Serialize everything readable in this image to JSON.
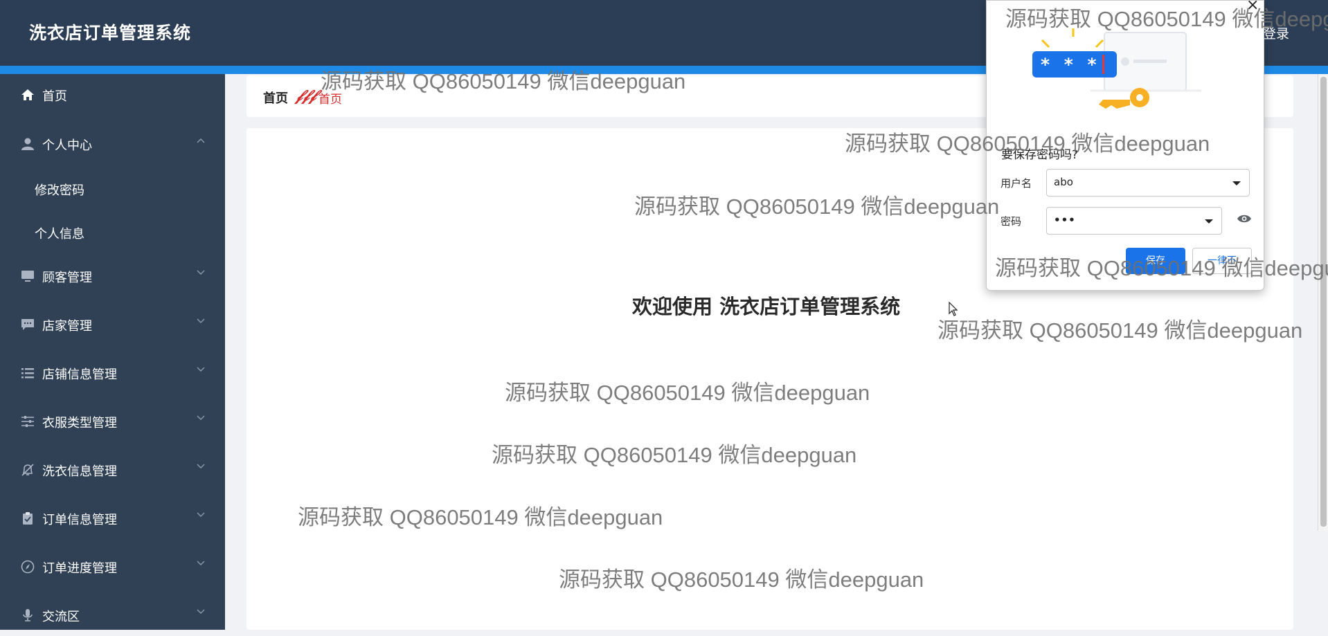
{
  "header": {
    "title": "洗衣店订单管理系统",
    "login_label": "登录"
  },
  "sidebar": {
    "items": [
      {
        "label": "首页",
        "icon": "home-icon",
        "expandable": false
      },
      {
        "label": "个人中心",
        "icon": "user-icon",
        "expandable": true,
        "expanded": true
      },
      {
        "label": "修改密码",
        "submenu": true
      },
      {
        "label": "个人信息",
        "submenu": true
      },
      {
        "label": "顾客管理",
        "icon": "monitor-icon",
        "expandable": true
      },
      {
        "label": "店家管理",
        "icon": "chat-icon",
        "expandable": true
      },
      {
        "label": "店铺信息管理",
        "icon": "list-icon",
        "expandable": true
      },
      {
        "label": "衣服类型管理",
        "icon": "sliders-icon",
        "expandable": true
      },
      {
        "label": "洗衣信息管理",
        "icon": "bell-off-icon",
        "expandable": true
      },
      {
        "label": "订单信息管理",
        "icon": "clipboard-icon",
        "expandable": true
      },
      {
        "label": "订单进度管理",
        "icon": "compass-icon",
        "expandable": true
      },
      {
        "label": "交流区",
        "icon": "microphone-icon",
        "expandable": true
      }
    ]
  },
  "breadcrumb": {
    "home": "首页",
    "separator": "𝒻𝒻𝒻",
    "current": "首页"
  },
  "main": {
    "welcome": "欢迎使用 洗衣店订单管理系统"
  },
  "password_dialog": {
    "question": "要保存密码吗?",
    "username_label": "用户名",
    "username_value": "abo",
    "password_label": "密码",
    "password_value": "•••",
    "save_label": "保存",
    "never_label": "一律不",
    "illustration_stars": "* * *"
  },
  "watermark_text": "源码获取 QQ86050149 微信deepguan",
  "colors": {
    "header_bg": "#2c3e55",
    "sidebar_bg": "#304156",
    "accent_blue": "#1e8ae6",
    "breadcrumb_red": "#d62b2b",
    "button_blue": "#1a73e8"
  }
}
